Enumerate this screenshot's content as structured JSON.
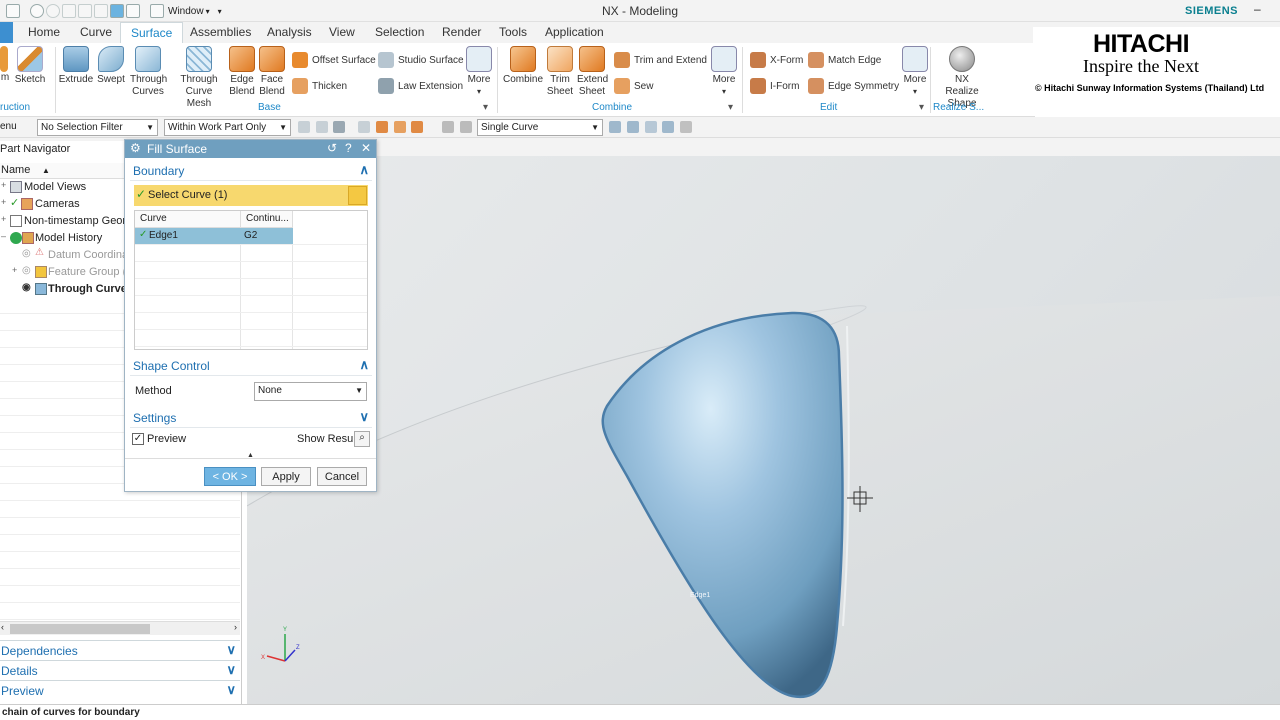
{
  "titlebar": {
    "app_title": "NX - Modeling",
    "window_menu": "Window",
    "brand": "SIEMENS"
  },
  "menu": {
    "tabs": [
      "Home",
      "Curve",
      "Surface",
      "Assemblies",
      "Analysis",
      "View",
      "Selection",
      "Render",
      "Tools",
      "Application"
    ],
    "active": "Surface"
  },
  "ribbon": {
    "construction_group": "ruction",
    "sketch": "Sketch",
    "sketch_prefix": "m",
    "base_buttons": [
      "Extrude",
      "Swept",
      "Through Curves",
      "Through Curve Mesh",
      "Edge Blend",
      "Face Blend"
    ],
    "offset_surface": "Offset Surface",
    "thicken": "Thicken",
    "studio_surface": "Studio Surface",
    "law_extension": "Law Extension",
    "more": "More",
    "base_group": "Base",
    "combine_buttons": [
      "Combine",
      "Trim Sheet",
      "Extend Sheet"
    ],
    "trim_and_extend": "Trim and Extend",
    "sew": "Sew",
    "combine_group": "Combine",
    "xform": "X-Form",
    "iform": "I-Form",
    "match_edge": "Match Edge",
    "edge_symmetry": "Edge Symmetry",
    "edit_group": "Edit",
    "nx_realize_shape": "NX Realize Shape",
    "realize_group": "Realize S..."
  },
  "logo": {
    "hitachi": "HITACHI",
    "tagline": "Inspire the Next",
    "company": "© Hitachi Sunway Information Systems (Thailand) Ltd"
  },
  "selection_bar": {
    "menu_stub": "enu",
    "filter": "No Selection Filter",
    "scope": "Within Work Part Only",
    "curve_rule": "Single Curve"
  },
  "navigator": {
    "title": "Part Navigator",
    "column": "Name",
    "items": [
      {
        "label": "Model Views",
        "style": "normal"
      },
      {
        "label": "Cameras",
        "style": "normal"
      },
      {
        "label": "Non-timestamp Geon",
        "style": "normal"
      },
      {
        "label": "Model History",
        "style": "normal"
      },
      {
        "label": "Datum Coordina",
        "style": "dim"
      },
      {
        "label": "Feature Group (6",
        "style": "dim"
      },
      {
        "label": "Through Curves",
        "style": "bold"
      }
    ],
    "panels": [
      "Dependencies",
      "Details",
      "Preview"
    ]
  },
  "dialog": {
    "title": "Fill Surface",
    "boundary_section": "Boundary",
    "select_curve": "Select Curve (1)",
    "table": {
      "headers": [
        "Curve",
        "Continu..."
      ],
      "rows": [
        {
          "curve": "Edge1",
          "continuity": "G2"
        }
      ]
    },
    "shape_control_section": "Shape Control",
    "method_label": "Method",
    "method_value": "None",
    "settings_section": "Settings",
    "preview_label": "Preview",
    "preview_checked": true,
    "show_result": "Show Result",
    "ok": "< OK >",
    "apply": "Apply",
    "cancel": "Cancel"
  },
  "viewport": {
    "edge_label": "Edge1",
    "triad_labels": [
      "Y",
      "X",
      "Z"
    ]
  },
  "status": {
    "message": "chain of curves for boundary"
  },
  "colors": {
    "accent": "#1e88c8",
    "dialog_title": "#6f9fbf",
    "selection_yellow": "#f7d86e",
    "surface_blue": "#7eaecf"
  }
}
